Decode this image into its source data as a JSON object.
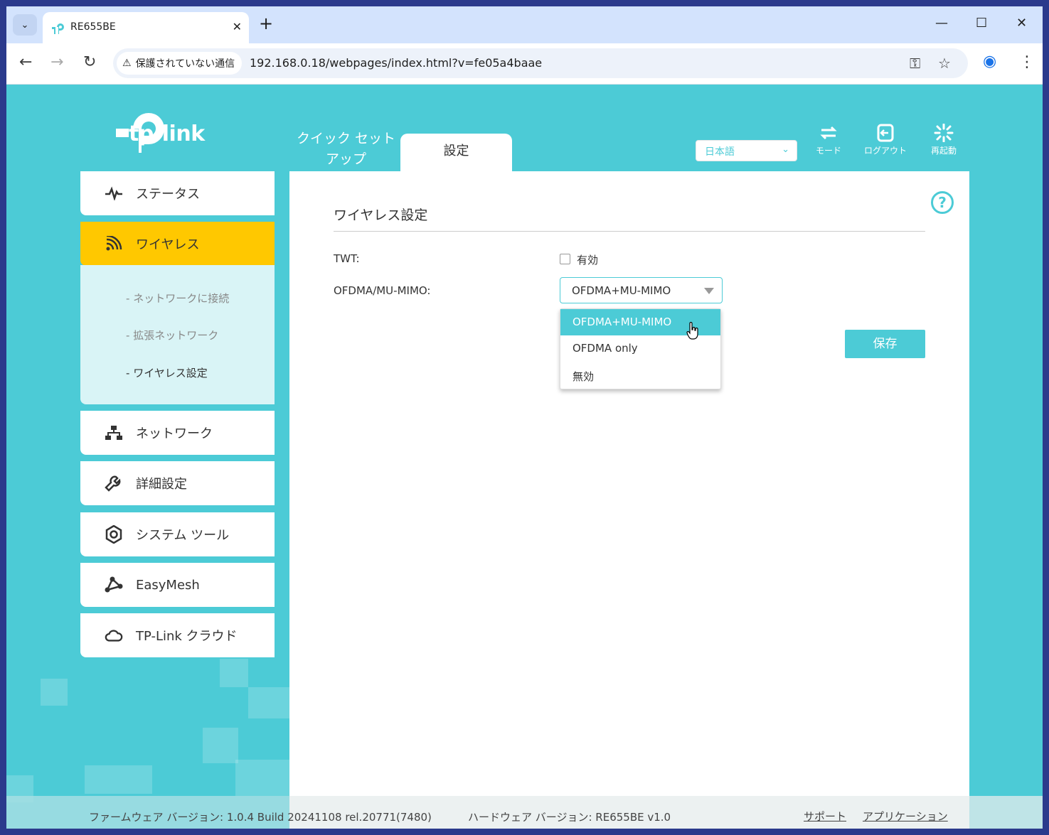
{
  "browser": {
    "tab_title": "RE655BE",
    "security_label": "保護されていない通信",
    "url": "192.168.0.18/webpages/index.html?v=fe05a4baae"
  },
  "brand": {
    "logo_text": "tp-link"
  },
  "top_nav": {
    "quick_setup": "クイック セット アップ",
    "settings": "設定",
    "language": "日本語",
    "mode": "モード",
    "logout": "ログアウト",
    "reboot": "再起動"
  },
  "sidebar": {
    "status": "ステータス",
    "wireless": "ワイヤレス",
    "wireless_sub": [
      "ネットワークに接続",
      "拡張ネットワーク",
      "ワイヤレス設定"
    ],
    "network": "ネットワーク",
    "advanced": "詳細設定",
    "system_tools": "システム ツール",
    "easymesh": "EasyMesh",
    "cloud": "TP-Link クラウド"
  },
  "content": {
    "title": "ワイヤレス設定",
    "twt_label": "TWT:",
    "twt_checkbox_label": "有効",
    "twt_enabled": false,
    "ofdma_label": "OFDMA/MU-MIMO:",
    "ofdma_value": "OFDMA+MU-MIMO",
    "ofdma_options": [
      "OFDMA+MU-MIMO",
      "OFDMA only",
      "無効"
    ],
    "save": "保存"
  },
  "footer": {
    "firmware": "ファームウェア バージョン: 1.0.4 Build 20241108 rel.20771(7480)",
    "hardware": "ハードウェア バージョン: RE655BE v1.0",
    "support": "サポート",
    "app": "アプリケーション"
  },
  "colors": {
    "accent": "#4ccbd6",
    "active": "#ffc800"
  }
}
